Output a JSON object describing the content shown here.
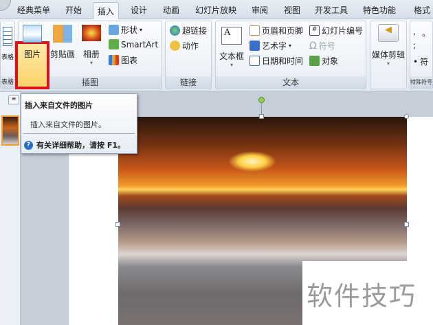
{
  "tabs": [
    "经典菜单",
    "开始",
    "插入",
    "设计",
    "动画",
    "幻灯片放映",
    "审阅",
    "视图",
    "开发工具",
    "特色功能",
    "格式"
  ],
  "active_tab": "插入",
  "ribbon": {
    "table_group": {
      "button": "表格",
      "label": "表格"
    },
    "illustrations": {
      "label": "插图",
      "picture": "图片",
      "clipart": "剪贴画",
      "album": "相册",
      "shapes": "形状",
      "smartart": "SmartArt",
      "chart": "图表"
    },
    "links": {
      "label": "链接",
      "hyperlink": "超链接",
      "action": "动作"
    },
    "text": {
      "label": "文本",
      "textbox": "文本框",
      "header_footer": "页眉和页脚",
      "wordart": "艺术字",
      "datetime": "日期和时间",
      "slide_number": "幻灯片编号",
      "symbol": "符号",
      "object": "对象"
    },
    "media": {
      "label": "媒体剪辑",
      "button": "媒体剪辑"
    },
    "special": {
      "label": "特殊符号",
      "items": [
        ",",
        "。",
        ";",
        "符"
      ]
    }
  },
  "tooltip": {
    "title": "插入来自文件的图片",
    "body": "插入来自文件的图片。",
    "help": "有关详细帮助，请按 F1。"
  },
  "watermark": "软件技巧",
  "colors": {
    "highlight": "#d9131e"
  }
}
